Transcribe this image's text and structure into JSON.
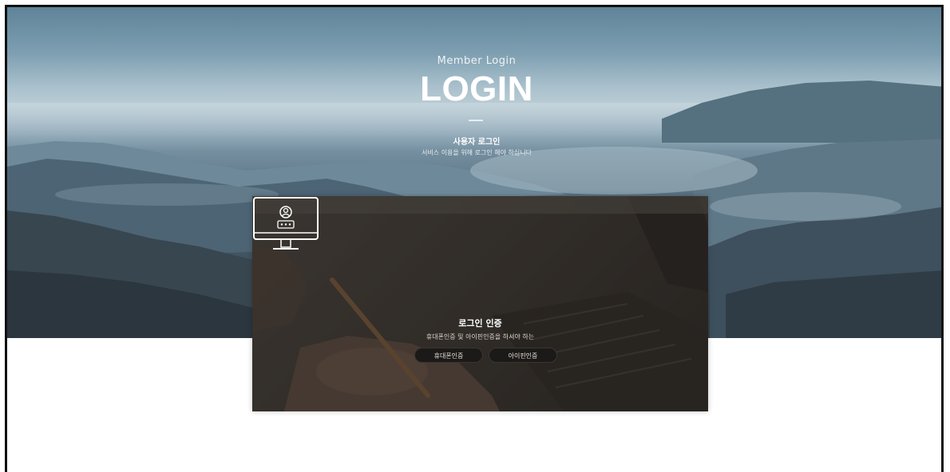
{
  "hero": {
    "subtitle": "Member Login",
    "title": "LOGIN",
    "heading": "사용자 로그인",
    "description": "서비스 이용을 위해 로그인 해야 하십니다"
  },
  "auth_card": {
    "icon": "monitor-user-icon",
    "title": "로그인 인증",
    "description": "휴대폰인증 및 아이핀인증을 하셔야 하는",
    "buttons": {
      "phone": "휴대폰인증",
      "ipin": "아이핀인증"
    }
  },
  "colors": {
    "button_bg": "#1c1a18",
    "card_bg": "#3d3832",
    "text_light": "#ffffff"
  }
}
